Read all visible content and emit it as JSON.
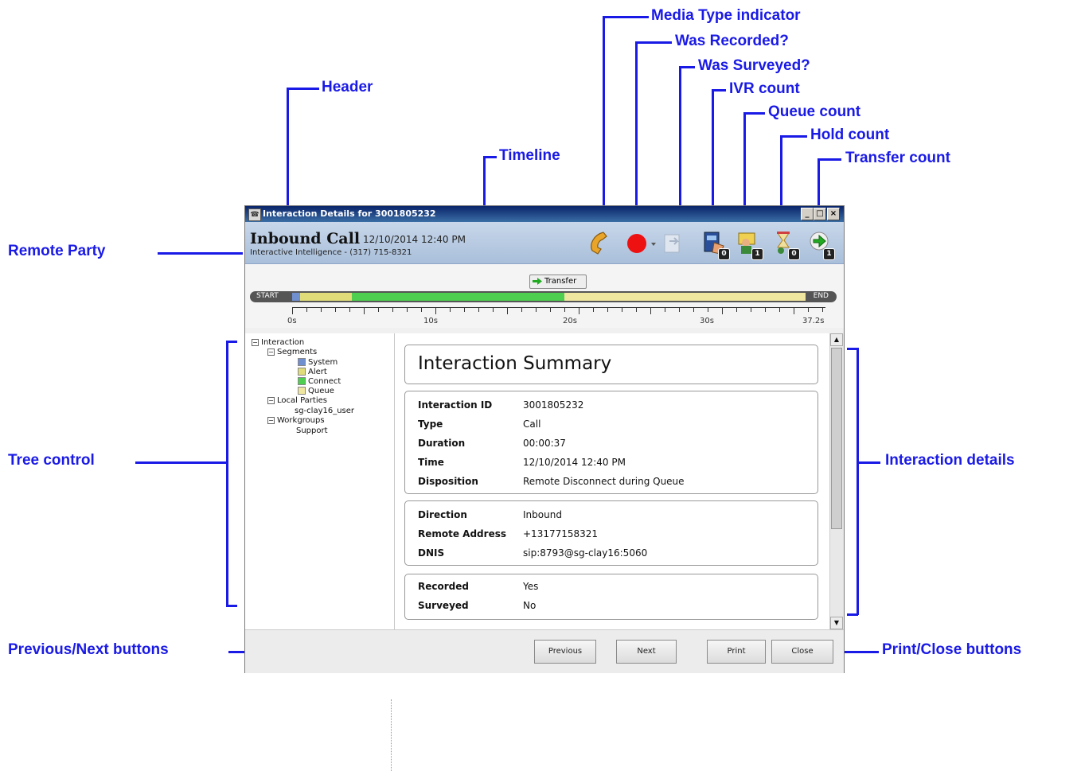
{
  "window": {
    "title": "Interaction Details for 3001805232",
    "minimize": "_",
    "maximize": "□",
    "close": "×"
  },
  "header": {
    "call_title": "Inbound Call",
    "datetime": "12/10/2014 12:40 PM",
    "remote_party": "Interactive Intelligence - (317) 715-8321",
    "ivr_count": "0",
    "queue_count": "1",
    "hold_count": "0",
    "transfer_count": "1"
  },
  "timeline": {
    "transfer_label": "Transfer",
    "start_label": "START",
    "end_label": "END",
    "ticks": [
      "0s",
      "10s",
      "20s",
      "30s",
      "37.2s"
    ],
    "total_seconds": 37.2,
    "segments": [
      {
        "name": "System",
        "color": "#6f8fcf",
        "start": 0,
        "end": 0.6
      },
      {
        "name": "Alert",
        "color": "#e0dc7a",
        "start": 0.6,
        "end": 4.3
      },
      {
        "name": "Connect",
        "color": "#4fcf4f",
        "start": 4.3,
        "end": 19.7
      },
      {
        "name": "Queue",
        "color": "#efe6a0",
        "start": 19.7,
        "end": 37.2
      }
    ]
  },
  "tree": {
    "root": "Interaction",
    "segments_label": "Segments",
    "segments": [
      {
        "label": "System",
        "color": "#6f8fcf"
      },
      {
        "label": "Alert",
        "color": "#e0dc7a"
      },
      {
        "label": "Connect",
        "color": "#4fcf4f"
      },
      {
        "label": "Queue",
        "color": "#efe6a0"
      }
    ],
    "local_parties_label": "Local Parties",
    "local_party": "sg-clay16_user",
    "workgroups_label": "Workgroups",
    "workgroup": "Support"
  },
  "summary": {
    "title": "Interaction Summary",
    "group1": [
      {
        "key": "Interaction ID",
        "value": "3001805232"
      },
      {
        "key": "Type",
        "value": "Call"
      },
      {
        "key": "Duration",
        "value": "00:00:37"
      },
      {
        "key": "Time",
        "value": "12/10/2014 12:40 PM"
      },
      {
        "key": "Disposition",
        "value": "Remote Disconnect during Queue"
      }
    ],
    "group2": [
      {
        "key": "Direction",
        "value": "Inbound"
      },
      {
        "key": "Remote Address",
        "value": "+13177158321"
      },
      {
        "key": "DNIS",
        "value": "sip:8793@sg-clay16:5060"
      }
    ],
    "group3": [
      {
        "key": "Recorded",
        "value": "Yes"
      },
      {
        "key": "Surveyed",
        "value": "No"
      }
    ]
  },
  "footer": {
    "previous": "Previous",
    "next": "Next",
    "print": "Print",
    "close": "Close"
  },
  "callouts": {
    "media_type": "Media Type indicator",
    "was_recorded": "Was Recorded?",
    "was_surveyed": "Was Surveyed?",
    "ivr_count": "IVR count",
    "header": "Header",
    "queue_count": "Queue count",
    "hold_count": "Hold count",
    "timeline": "Timeline",
    "transfer_count": "Transfer count",
    "remote_party": "Remote Party",
    "tree_control": "Tree control",
    "interaction_details": "Interaction details",
    "prev_next": "Previous/Next buttons",
    "print_close": "Print/Close buttons"
  }
}
